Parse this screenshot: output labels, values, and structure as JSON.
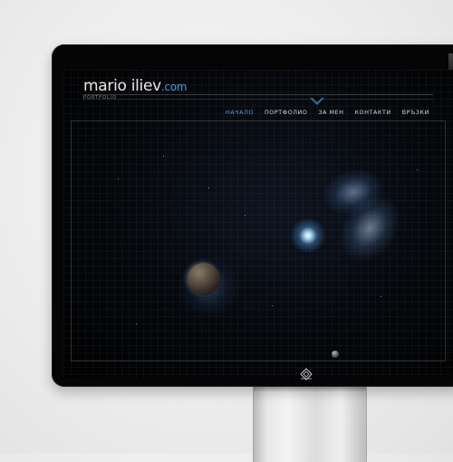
{
  "site": {
    "logo_main": "mario iliev",
    "logo_tld": ".com",
    "logo_sub": "PORTFOLIO"
  },
  "nav": {
    "items": [
      {
        "label": "НАЧАЛО",
        "active": true
      },
      {
        "label": "ПОРТФОЛИО",
        "active": false
      },
      {
        "label": "ЗА МЕН",
        "active": false
      },
      {
        "label": "КОНТАКТИ",
        "active": false
      },
      {
        "label": "ВРЪЗКИ",
        "active": false
      }
    ]
  },
  "colors": {
    "accent": "#4aa3da",
    "screen_bg": "#000000",
    "monitor_bezel": "#050505",
    "backdrop": "#ececec"
  },
  "icons": {
    "footer": "diamond-logo-icon"
  }
}
